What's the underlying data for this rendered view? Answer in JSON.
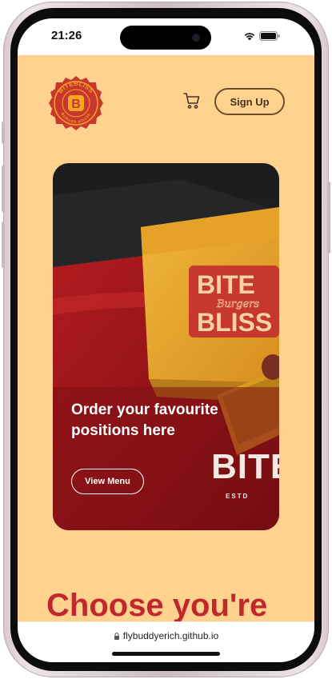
{
  "status_bar": {
    "time": "21:26"
  },
  "header": {
    "logo_text": "BITEBLISS",
    "logo_letter": "B",
    "logo_subtext": "BURGER HOUSE",
    "cart_icon": "shopping-cart-icon",
    "signup_label": "Sign Up"
  },
  "hero": {
    "headline": "Order your favourite positions here",
    "button_label": "View Menu",
    "bag_text_top": "BITE",
    "bag_text_script": "Burgers",
    "bag_text_bottom": "BLISS",
    "brand_mark": "BITE",
    "estd": "ESTD"
  },
  "section": {
    "heading": "Choose you're"
  },
  "browser": {
    "url": "flybuddyerich.github.io",
    "lock_icon": "lock-icon"
  },
  "colors": {
    "page_bg": "#ffd38f",
    "accent_red": "#c0282d",
    "logo_gold": "#f2a623",
    "logo_red": "#c9372f"
  }
}
